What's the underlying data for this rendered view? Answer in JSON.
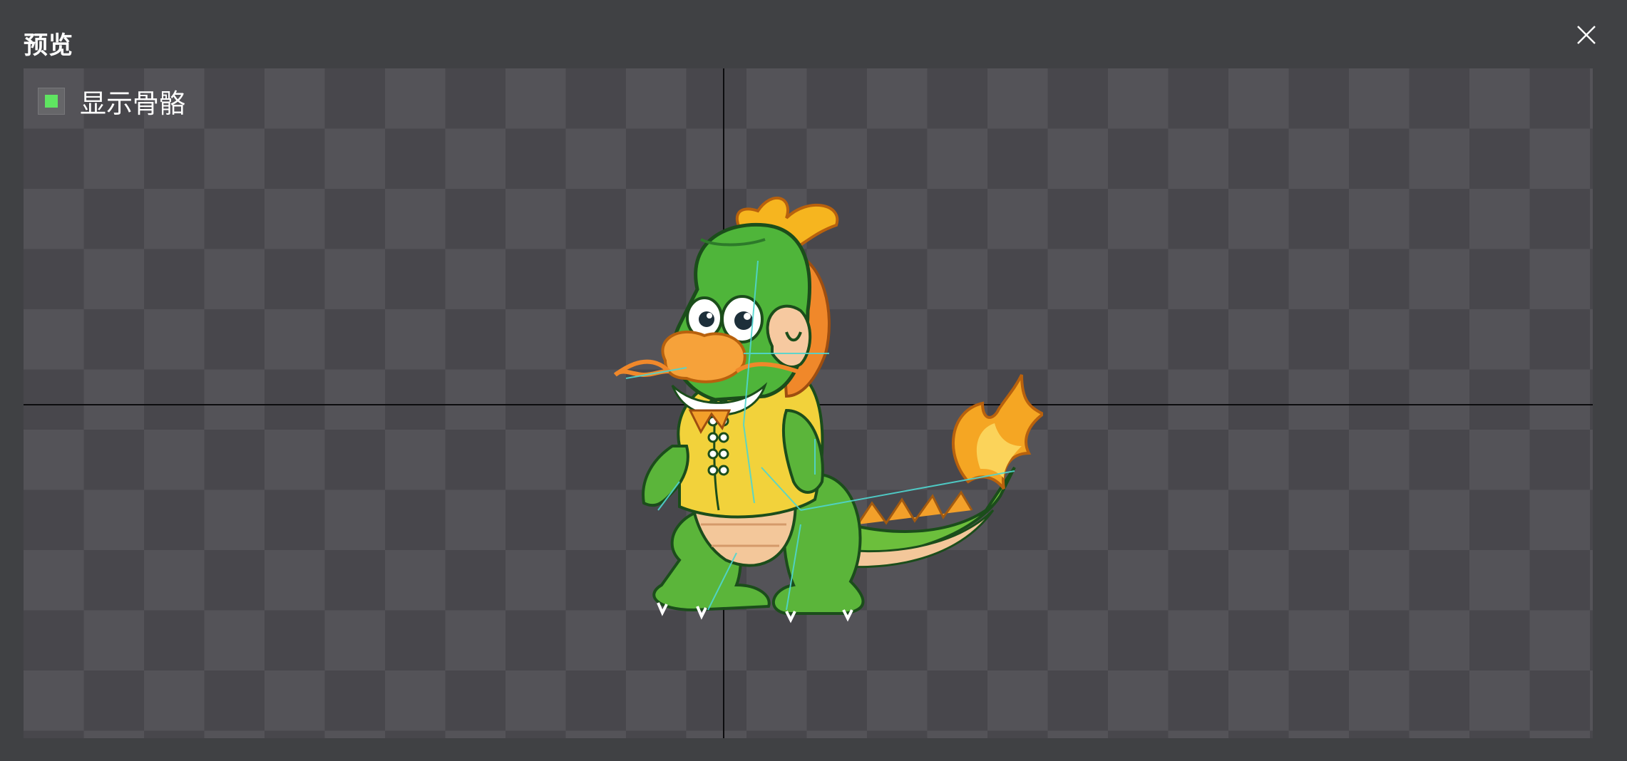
{
  "dialog": {
    "title": "预览",
    "close_icon": "close-icon"
  },
  "preview": {
    "show_bones": {
      "label": "显示骨骼",
      "checked": true,
      "check_color": "#5fe561"
    },
    "colors": {
      "checker_light": "#545358",
      "checker_dark": "#48474c",
      "axis": "#0c0c0e",
      "bone": "#4fd6d0"
    }
  }
}
